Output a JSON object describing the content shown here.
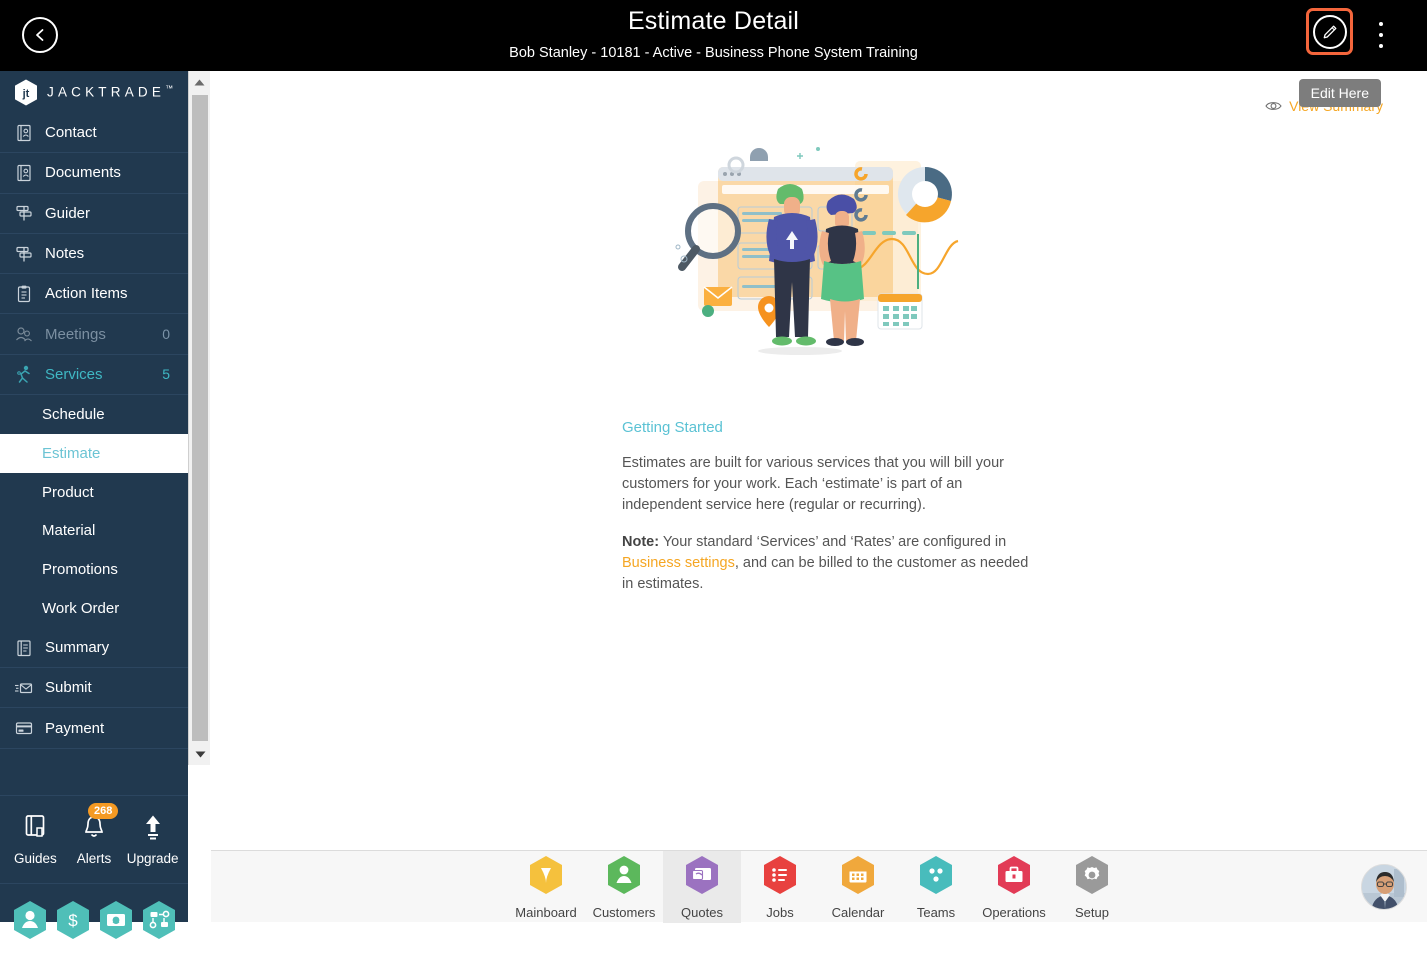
{
  "header": {
    "title": "Estimate Detail",
    "subtitle": "Bob Stanley - 10181 - Active - Business Phone System Training",
    "back_icon": "chevron-left-icon",
    "edit_icon": "pencil-icon",
    "menu_icon": "kebab-menu-icon",
    "accent": "#f4663c"
  },
  "sidebar": {
    "brand": "JACKTRADE",
    "brand_tm": "™",
    "items": [
      {
        "label": "Contact",
        "icon": "address-book-icon",
        "count": "",
        "state": "normal",
        "type": "item"
      },
      {
        "label": "Documents",
        "icon": "address-book-icon",
        "count": "",
        "state": "normal",
        "type": "item"
      },
      {
        "label": "Guider",
        "icon": "signpost-icon",
        "count": "",
        "state": "normal",
        "type": "item"
      },
      {
        "label": "Notes",
        "icon": "signpost-icon",
        "count": "",
        "state": "normal",
        "type": "item"
      },
      {
        "label": "Action Items",
        "icon": "clipboard-icon",
        "count": "",
        "state": "normal",
        "type": "item"
      },
      {
        "label": "Meetings",
        "icon": "meetings-icon",
        "count": "0",
        "state": "dim",
        "type": "item"
      },
      {
        "label": "Services",
        "icon": "services-icon",
        "count": "5",
        "state": "teal",
        "type": "item"
      },
      {
        "label": "Schedule",
        "icon": "",
        "count": "",
        "state": "normal",
        "type": "sub"
      },
      {
        "label": "Estimate",
        "icon": "",
        "count": "",
        "state": "active",
        "type": "sub"
      },
      {
        "label": "Product",
        "icon": "",
        "count": "",
        "state": "normal",
        "type": "sub"
      },
      {
        "label": "Material",
        "icon": "",
        "count": "",
        "state": "normal",
        "type": "sub"
      },
      {
        "label": "Promotions",
        "icon": "",
        "count": "",
        "state": "normal",
        "type": "sub"
      },
      {
        "label": "Work Order",
        "icon": "",
        "count": "",
        "state": "normal",
        "type": "sub"
      },
      {
        "label": "Summary",
        "icon": "book-icon",
        "count": "",
        "state": "normal",
        "type": "item"
      },
      {
        "label": "Submit",
        "icon": "envelope-send-icon",
        "count": "",
        "state": "normal",
        "type": "item"
      },
      {
        "label": "Payment",
        "icon": "credit-card-icon",
        "count": "",
        "state": "normal",
        "type": "item"
      }
    ],
    "footer": [
      {
        "label": "Guides",
        "icon": "guides-book-icon",
        "badge": ""
      },
      {
        "label": "Alerts",
        "icon": "bell-icon",
        "badge": "268"
      },
      {
        "label": "Upgrade",
        "icon": "up-arrow-icon",
        "badge": ""
      }
    ],
    "quick_hex": [
      {
        "icon": "person-hex-icon"
      },
      {
        "icon": "dollar-hex-icon"
      },
      {
        "icon": "money-hex-icon"
      },
      {
        "icon": "workflow-hex-icon"
      }
    ],
    "bg": "#21394f",
    "badge_color": "#f59a23",
    "teal": "#3fb8c4"
  },
  "main": {
    "view_summary": "View Summary",
    "view_summary_icon": "eye-icon",
    "tooltip": "Edit Here",
    "illustration_icon": "analytics-people-illustration",
    "getting_started_heading": "Getting Started",
    "paragraph_1": "Estimates are built for various services that you will bill your customers for your work. Each ‘estimate’ is part of an independent service here (regular or recurring).",
    "note_label": "Note:",
    "note_text_before": " Your standard ‘Services’ and ‘Rates’ are configured in ",
    "note_link": "Business settings",
    "note_text_after": ", and can be billed to the customer as needed in estimates.",
    "link_color": "#f5a623",
    "heading_color": "#5bc2d4"
  },
  "bottom_nav": {
    "items": [
      {
        "label": "Mainboard",
        "icon": "mainboard-hex-icon",
        "color": "#f5c13d",
        "selected": false
      },
      {
        "label": "Customers",
        "icon": "customers-hex-icon",
        "color": "#5cb85c",
        "selected": false
      },
      {
        "label": "Quotes",
        "icon": "quotes-hex-icon",
        "color": "#9b72c0",
        "selected": true
      },
      {
        "label": "Jobs",
        "icon": "jobs-hex-icon",
        "color": "#e8413f",
        "selected": false
      },
      {
        "label": "Calendar",
        "icon": "calendar-hex-icon",
        "color": "#f0a83c",
        "selected": false
      },
      {
        "label": "Teams",
        "icon": "teams-hex-icon",
        "color": "#48bcbc",
        "selected": false
      },
      {
        "label": "Operations",
        "icon": "operations-hex-icon",
        "color": "#e23b56",
        "selected": false
      },
      {
        "label": "Setup",
        "icon": "setup-hex-icon",
        "color": "#9a9a9a",
        "selected": false
      }
    ],
    "avatar_icon": "user-avatar-icon"
  }
}
